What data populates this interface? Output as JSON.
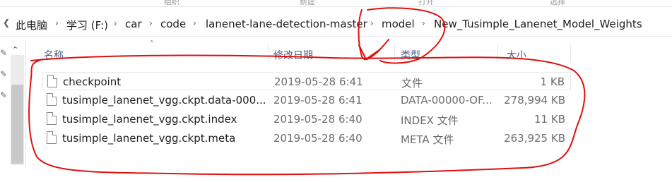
{
  "ribbon": {
    "fragments": [
      "组织",
      "新建",
      "打开",
      "选择"
    ]
  },
  "address": {
    "segments": [
      "此电脑",
      "学习 (F:)",
      "car",
      "code",
      "lanenet-lane-detection-master",
      "model",
      "New_Tusimple_Lanenet_Model_Weights"
    ]
  },
  "columns": {
    "name": "名称",
    "modified": "修改日期",
    "type": "类型",
    "size": "大小"
  },
  "files": [
    {
      "name": "checkpoint",
      "modified": "2019-05-28 6:41",
      "type": "文件",
      "size": "1 KB"
    },
    {
      "name": "tusimple_lanenet_vgg.ckpt.data-000...",
      "modified": "2019-05-28 6:41",
      "type": "DATA-00000-OF...",
      "size": "278,994 KB"
    },
    {
      "name": "tusimple_lanenet_vgg.ckpt.index",
      "modified": "2019-05-28 6:40",
      "type": "INDEX 文件",
      "size": "11 KB"
    },
    {
      "name": "tusimple_lanenet_vgg.ckpt.meta",
      "modified": "2019-05-28 6:40",
      "type": "META 文件",
      "size": "263,925 KB"
    }
  ],
  "annotation_color": "#e01010"
}
